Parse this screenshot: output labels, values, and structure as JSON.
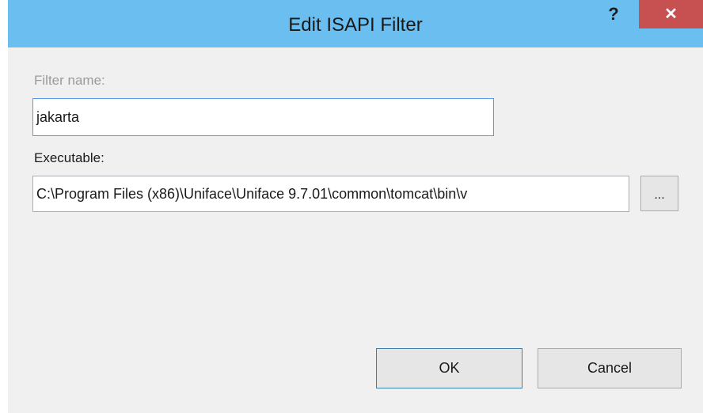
{
  "window": {
    "title": "Edit ISAPI Filter",
    "help_label": "?",
    "close_label": "✕"
  },
  "form": {
    "filter_name_label": "Filter name:",
    "filter_name_value": "jakarta",
    "executable_label": "Executable:",
    "executable_value": "C:\\Program Files (x86)\\Uniface\\Uniface 9.7.01\\common\\tomcat\\bin\\v",
    "browse_label": "..."
  },
  "buttons": {
    "ok_label": "OK",
    "cancel_label": "Cancel"
  },
  "colors": {
    "titlebar": "#6bbef0",
    "close_button": "#c75050",
    "focus_border": "#569de5"
  }
}
